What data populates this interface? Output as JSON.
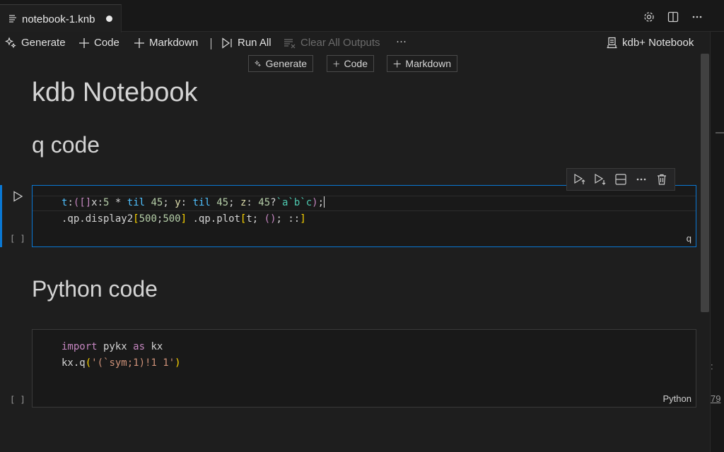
{
  "tab": {
    "title": "notebook-1.knb"
  },
  "toolbar": {
    "generate": "Generate",
    "code": "Code",
    "markdown": "Markdown",
    "run_all": "Run All",
    "clear_all": "Clear All Outputs",
    "more": "···",
    "kernel": "kdb+ Notebook"
  },
  "insert_bar": {
    "generate": "Generate",
    "code": "Code",
    "markdown": "Markdown"
  },
  "markdown": {
    "h1": "kdb Notebook",
    "q_heading": "q code",
    "py_heading": "Python code"
  },
  "cells": {
    "q": {
      "lang": "q",
      "exec": "[ ]"
    },
    "py": {
      "lang": "Python",
      "exec": "[ ]"
    }
  },
  "right_strip": {
    "t1": ":",
    "t2": "79"
  },
  "colors": {
    "accent": "#0a78d4",
    "background": "#1e1e1e"
  }
}
